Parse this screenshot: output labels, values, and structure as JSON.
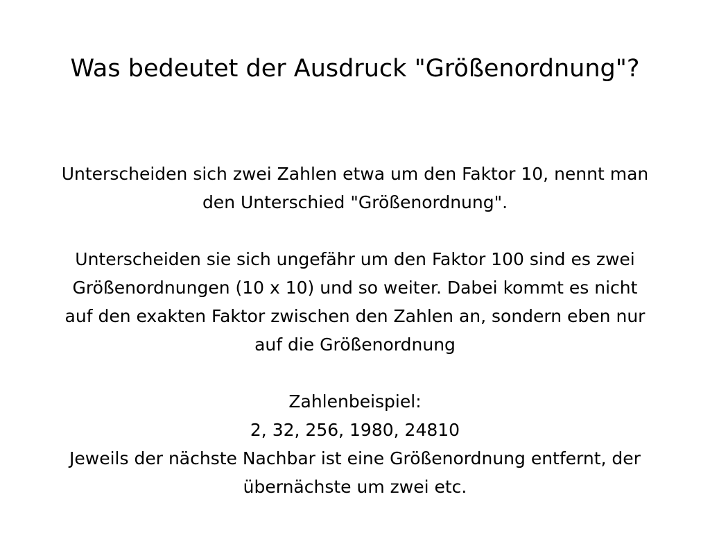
{
  "slide": {
    "title": "Was bedeutet der Ausdruck \"Größenordnung\"?",
    "body": {
      "lines": [
        "Unterscheiden sich zwei Zahlen etwa um den Faktor 10, nennt man",
        "den Unterschied \"Größenordnung\".",
        "Unterscheiden sie sich ungefähr um den Faktor 100 sind es zwei",
        "Größenordnungen (10 x 10) und so weiter. Dabei kommt es nicht",
        "auf den exakten Faktor zwischen den Zahlen an, sondern eben nur",
        "auf die Größenordnung",
        "Zahlenbeispiel:",
        "2, 32, 256, 1980, 24810",
        "Jeweils der nächste Nachbar ist eine Größenordnung entfernt, der",
        "übernächste um zwei etc."
      ]
    }
  }
}
